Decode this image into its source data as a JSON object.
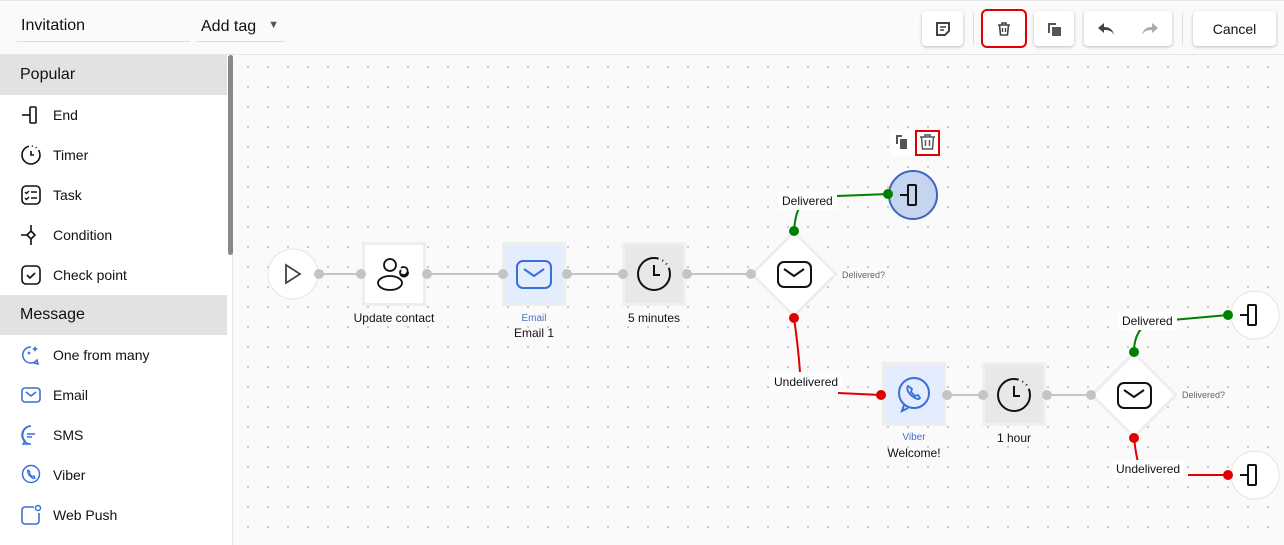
{
  "header": {
    "title": "Invitation",
    "tag_label": "Add tag",
    "cancel_label": "Cancel"
  },
  "toolbar": {
    "icons": [
      "note-icon",
      "trash-icon",
      "copy-icon",
      "undo-icon",
      "redo-icon"
    ],
    "highlight_color": "#e00000"
  },
  "sidebar": {
    "sections": [
      {
        "title": "Popular",
        "items": [
          {
            "label": "End",
            "icon": "end-icon"
          },
          {
            "label": "Timer",
            "icon": "timer-icon"
          },
          {
            "label": "Task",
            "icon": "task-icon"
          },
          {
            "label": "Condition",
            "icon": "condition-icon"
          },
          {
            "label": "Check point",
            "icon": "checkpoint-icon"
          }
        ]
      },
      {
        "title": "Message",
        "items": [
          {
            "label": "One from many",
            "icon": "sparkle-chat-icon"
          },
          {
            "label": "Email",
            "icon": "email-icon"
          },
          {
            "label": "SMS",
            "icon": "sms-icon"
          },
          {
            "label": "Viber",
            "icon": "viber-icon"
          },
          {
            "label": "Web Push",
            "icon": "webpush-icon"
          }
        ]
      }
    ]
  },
  "flow": {
    "update_contact": "Update contact",
    "email": {
      "type": "Email",
      "name": "Email 1"
    },
    "timer1": "5 minutes",
    "check1": {
      "question": "Delivered?",
      "yes": "Delivered",
      "no": "Undelivered"
    },
    "viber": {
      "type": "Viber",
      "name": "Welcome!"
    },
    "timer2": "1 hour",
    "check2": {
      "question": "Delivered?",
      "yes": "Delivered",
      "no": "Undelivered"
    },
    "colors": {
      "delivered": "#008000",
      "undelivered": "#e00000",
      "selected_fill": "#c5d5f0",
      "selected_stroke": "#3a66c0",
      "message_fill": "#e3edfd",
      "timer_fill": "#e8e8e8"
    }
  }
}
